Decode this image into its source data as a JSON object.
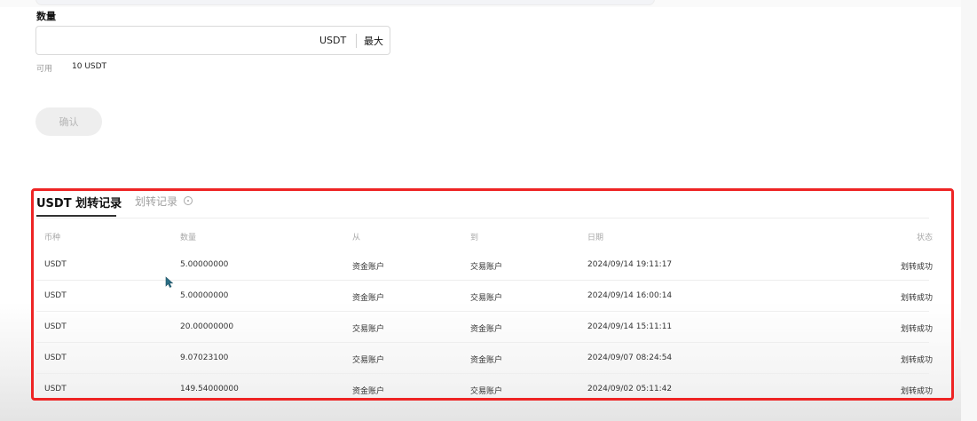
{
  "form": {
    "quantity_label": "数量",
    "quantity_value": "",
    "quantity_unit": "USDT",
    "max_label": "最大",
    "available_label": "可用",
    "available_value": "10 USDT",
    "confirm_label": "确认"
  },
  "tabs": {
    "active": "USDT 划转记录",
    "inactive": "划转记录"
  },
  "table": {
    "headers": [
      "币种",
      "数量",
      "从",
      "到",
      "日期",
      "状态"
    ],
    "rows": [
      [
        "USDT",
        "5.00000000",
        "资金账户",
        "交易账户",
        "2024/09/14 19:11:17",
        "划转成功"
      ],
      [
        "USDT",
        "5.00000000",
        "资金账户",
        "交易账户",
        "2024/09/14 16:00:14",
        "划转成功"
      ],
      [
        "USDT",
        "20.00000000",
        "交易账户",
        "资金账户",
        "2024/09/14 15:11:11",
        "划转成功"
      ],
      [
        "USDT",
        "9.07023100",
        "交易账户",
        "资金账户",
        "2024/09/07 08:24:54",
        "划转成功"
      ],
      [
        "USDT",
        "149.54000000",
        "资金账户",
        "交易账户",
        "2024/09/02 05:11:42",
        "划转成功"
      ]
    ]
  },
  "colors": {
    "highlight": "#ee2424",
    "cursor": "#2a6f86"
  }
}
